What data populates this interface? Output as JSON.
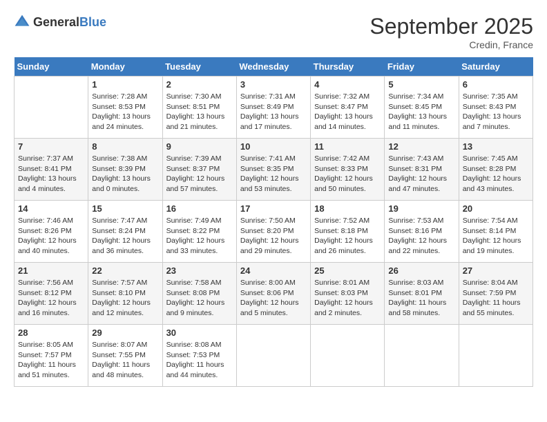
{
  "logo": {
    "text_general": "General",
    "text_blue": "Blue"
  },
  "header": {
    "month_year": "September 2025",
    "location": "Credin, France"
  },
  "days_of_week": [
    "Sunday",
    "Monday",
    "Tuesday",
    "Wednesday",
    "Thursday",
    "Friday",
    "Saturday"
  ],
  "weeks": [
    [
      {
        "day": "",
        "info": ""
      },
      {
        "day": "1",
        "info": "Sunrise: 7:28 AM\nSunset: 8:53 PM\nDaylight: 13 hours and 24 minutes."
      },
      {
        "day": "2",
        "info": "Sunrise: 7:30 AM\nSunset: 8:51 PM\nDaylight: 13 hours and 21 minutes."
      },
      {
        "day": "3",
        "info": "Sunrise: 7:31 AM\nSunset: 8:49 PM\nDaylight: 13 hours and 17 minutes."
      },
      {
        "day": "4",
        "info": "Sunrise: 7:32 AM\nSunset: 8:47 PM\nDaylight: 13 hours and 14 minutes."
      },
      {
        "day": "5",
        "info": "Sunrise: 7:34 AM\nSunset: 8:45 PM\nDaylight: 13 hours and 11 minutes."
      },
      {
        "day": "6",
        "info": "Sunrise: 7:35 AM\nSunset: 8:43 PM\nDaylight: 13 hours and 7 minutes."
      }
    ],
    [
      {
        "day": "7",
        "info": "Sunrise: 7:37 AM\nSunset: 8:41 PM\nDaylight: 13 hours and 4 minutes."
      },
      {
        "day": "8",
        "info": "Sunrise: 7:38 AM\nSunset: 8:39 PM\nDaylight: 13 hours and 0 minutes."
      },
      {
        "day": "9",
        "info": "Sunrise: 7:39 AM\nSunset: 8:37 PM\nDaylight: 12 hours and 57 minutes."
      },
      {
        "day": "10",
        "info": "Sunrise: 7:41 AM\nSunset: 8:35 PM\nDaylight: 12 hours and 53 minutes."
      },
      {
        "day": "11",
        "info": "Sunrise: 7:42 AM\nSunset: 8:33 PM\nDaylight: 12 hours and 50 minutes."
      },
      {
        "day": "12",
        "info": "Sunrise: 7:43 AM\nSunset: 8:31 PM\nDaylight: 12 hours and 47 minutes."
      },
      {
        "day": "13",
        "info": "Sunrise: 7:45 AM\nSunset: 8:28 PM\nDaylight: 12 hours and 43 minutes."
      }
    ],
    [
      {
        "day": "14",
        "info": "Sunrise: 7:46 AM\nSunset: 8:26 PM\nDaylight: 12 hours and 40 minutes."
      },
      {
        "day": "15",
        "info": "Sunrise: 7:47 AM\nSunset: 8:24 PM\nDaylight: 12 hours and 36 minutes."
      },
      {
        "day": "16",
        "info": "Sunrise: 7:49 AM\nSunset: 8:22 PM\nDaylight: 12 hours and 33 minutes."
      },
      {
        "day": "17",
        "info": "Sunrise: 7:50 AM\nSunset: 8:20 PM\nDaylight: 12 hours and 29 minutes."
      },
      {
        "day": "18",
        "info": "Sunrise: 7:52 AM\nSunset: 8:18 PM\nDaylight: 12 hours and 26 minutes."
      },
      {
        "day": "19",
        "info": "Sunrise: 7:53 AM\nSunset: 8:16 PM\nDaylight: 12 hours and 22 minutes."
      },
      {
        "day": "20",
        "info": "Sunrise: 7:54 AM\nSunset: 8:14 PM\nDaylight: 12 hours and 19 minutes."
      }
    ],
    [
      {
        "day": "21",
        "info": "Sunrise: 7:56 AM\nSunset: 8:12 PM\nDaylight: 12 hours and 16 minutes."
      },
      {
        "day": "22",
        "info": "Sunrise: 7:57 AM\nSunset: 8:10 PM\nDaylight: 12 hours and 12 minutes."
      },
      {
        "day": "23",
        "info": "Sunrise: 7:58 AM\nSunset: 8:08 PM\nDaylight: 12 hours and 9 minutes."
      },
      {
        "day": "24",
        "info": "Sunrise: 8:00 AM\nSunset: 8:06 PM\nDaylight: 12 hours and 5 minutes."
      },
      {
        "day": "25",
        "info": "Sunrise: 8:01 AM\nSunset: 8:03 PM\nDaylight: 12 hours and 2 minutes."
      },
      {
        "day": "26",
        "info": "Sunrise: 8:03 AM\nSunset: 8:01 PM\nDaylight: 11 hours and 58 minutes."
      },
      {
        "day": "27",
        "info": "Sunrise: 8:04 AM\nSunset: 7:59 PM\nDaylight: 11 hours and 55 minutes."
      }
    ],
    [
      {
        "day": "28",
        "info": "Sunrise: 8:05 AM\nSunset: 7:57 PM\nDaylight: 11 hours and 51 minutes."
      },
      {
        "day": "29",
        "info": "Sunrise: 8:07 AM\nSunset: 7:55 PM\nDaylight: 11 hours and 48 minutes."
      },
      {
        "day": "30",
        "info": "Sunrise: 8:08 AM\nSunset: 7:53 PM\nDaylight: 11 hours and 44 minutes."
      },
      {
        "day": "",
        "info": ""
      },
      {
        "day": "",
        "info": ""
      },
      {
        "day": "",
        "info": ""
      },
      {
        "day": "",
        "info": ""
      }
    ]
  ]
}
